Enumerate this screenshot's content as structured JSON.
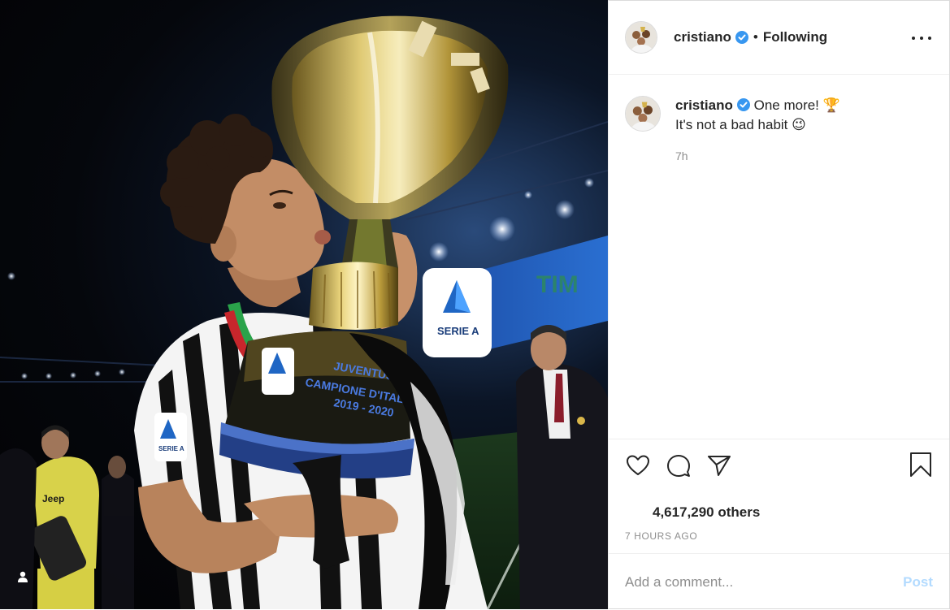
{
  "post": {
    "author": {
      "username": "cristiano",
      "verified": true,
      "separator": "•",
      "follow_status": "Following"
    },
    "caption": {
      "username": "cristiano",
      "line1": "One more! 🏆",
      "line2": "It's not a bad habit 😉",
      "time": "7h"
    },
    "likes": {
      "text": "4,617,290 others"
    },
    "posted_ago": "7 HOURS AGO",
    "comment": {
      "placeholder": "Add a comment...",
      "post_label": "Post"
    },
    "photo": {
      "trophy_text": [
        "JUVENTUS",
        "CAMPIONE D'ITALIA",
        "2019 - 2020"
      ],
      "banner_text": [
        "SERIE A",
        "TIM"
      ],
      "sleeve_text": "SERIE A"
    }
  },
  "icons": {
    "verified": "verified-badge-icon",
    "more": "more-options-icon",
    "like": "heart-icon",
    "comment": "comment-bubble-icon",
    "share": "paper-plane-icon",
    "save": "bookmark-icon",
    "tag": "user-tag-icon"
  },
  "colors": {
    "verified_blue": "#3897f0",
    "post_button_disabled": "#b3dbff",
    "meta_gray": "#8e8e8e",
    "text": "#262626"
  }
}
